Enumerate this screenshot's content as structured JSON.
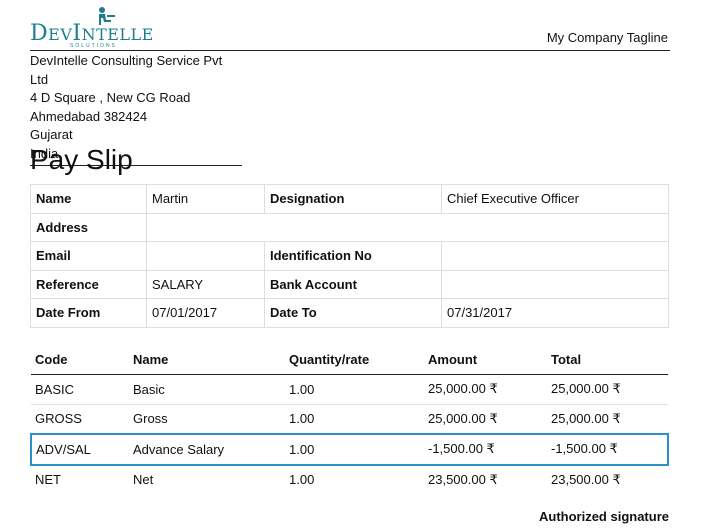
{
  "header": {
    "logo_text_cap": "D",
    "logo_text_small": "EV",
    "logo_text_cap2": "I",
    "logo_text_small2": "NTELLE",
    "logo_sub": "SOLUTIONS",
    "tagline": "My Company Tagline"
  },
  "company": {
    "name": "DevIntelle Consulting Service Pvt Ltd",
    "street": "4 D Square , New CG Road",
    "city_zip": "Ahmedabad 382424",
    "state": "Gujarat",
    "country": "India"
  },
  "title": "Pay Slip",
  "employee": {
    "name_label": "Name",
    "name": "Martin",
    "designation_label": "Designation",
    "designation": "Chief Executive Officer",
    "address_label": "Address",
    "address": "",
    "email_label": "Email",
    "email": "",
    "identification_label": "Identification No",
    "identification": "",
    "reference_label": "Reference",
    "reference": "SALARY",
    "bank_label": "Bank Account",
    "bank": "",
    "date_from_label": "Date From",
    "date_from": "07/01/2017",
    "date_to_label": "Date To",
    "date_to": "07/31/2017"
  },
  "lines": {
    "headers": [
      "Code",
      "Name",
      "Quantity/rate",
      "Amount",
      "Total"
    ],
    "rows": [
      [
        "BASIC",
        "Basic",
        "1.00",
        "25,000.00 ₹",
        "25,000.00 ₹"
      ],
      [
        "GROSS",
        "Gross",
        "1.00",
        "25,000.00 ₹",
        "25,000.00 ₹"
      ],
      [
        "ADV/SAL",
        "Advance Salary",
        "1.00",
        "-1,500.00 ₹",
        "-1,500.00 ₹"
      ],
      [
        "NET",
        "Net",
        "1.00",
        "23,500.00 ₹",
        "23,500.00 ₹"
      ]
    ]
  },
  "signature": "Authorized signature",
  "colors": {
    "brand": "#1d7f8e",
    "selection": "#2b8fc8"
  }
}
